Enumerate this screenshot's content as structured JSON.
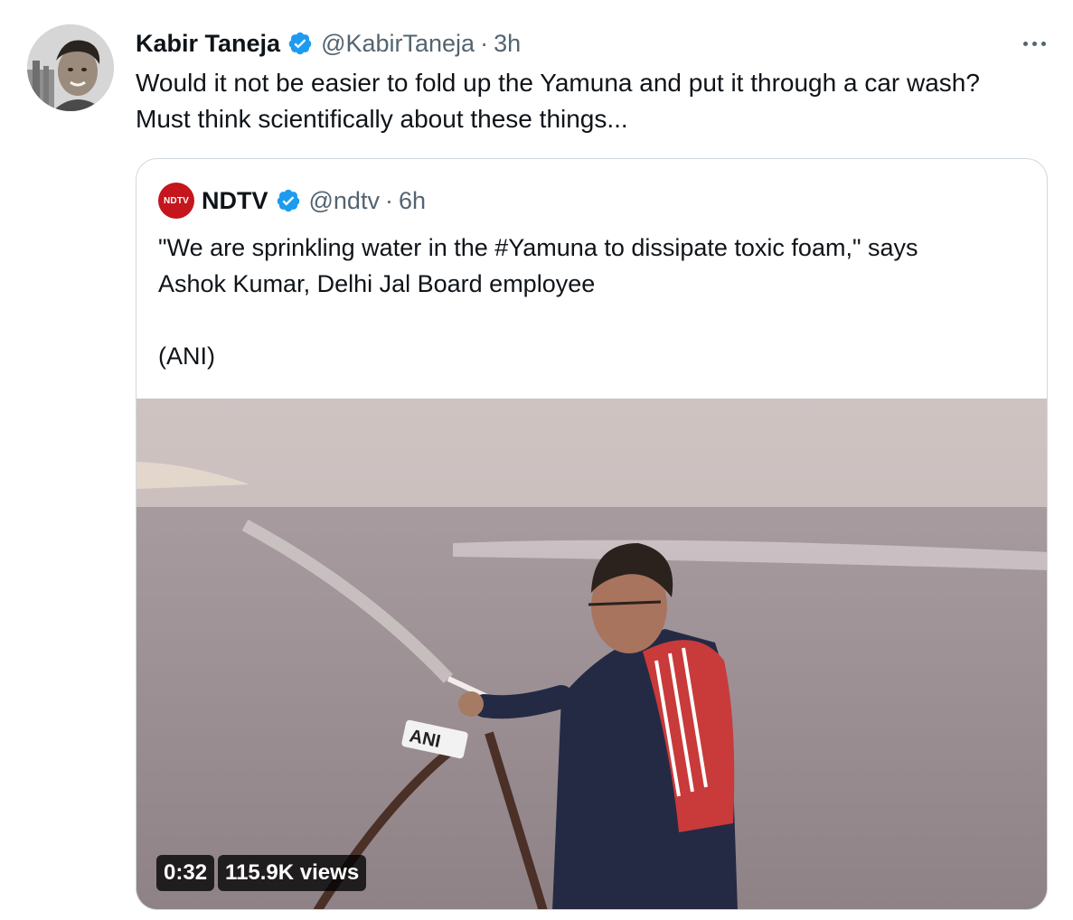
{
  "tweet": {
    "author_name": "Kabir Taneja",
    "author_handle": "@KabirTaneja",
    "separator": "·",
    "time": "3h",
    "text_lines": [
      "Would it not be easier to fold up the Yamuna and put it through a car wash?",
      "Must think scientifically about these things..."
    ]
  },
  "quoted": {
    "logo_text": "NDTV",
    "author_name": "NDTV",
    "author_handle": "@ndtv",
    "separator": "·",
    "time": "6h",
    "text_lines": [
      "\"We are sprinkling water in the #Yamuna to dissipate toxic foam,\" says",
      "Ashok Kumar, Delhi Jal Board employee",
      "",
      "(ANI)"
    ],
    "media": {
      "duration": "0:32",
      "views": "115.9K views",
      "mic_label": "ANI"
    }
  },
  "icons": {
    "verified": "verified-badge-icon",
    "more": "more-options-icon"
  },
  "colors": {
    "verified_blue": "#1d9bf0",
    "secondary_text": "#536471",
    "ndtv_red": "#c4161c",
    "border": "#cfd9de"
  }
}
